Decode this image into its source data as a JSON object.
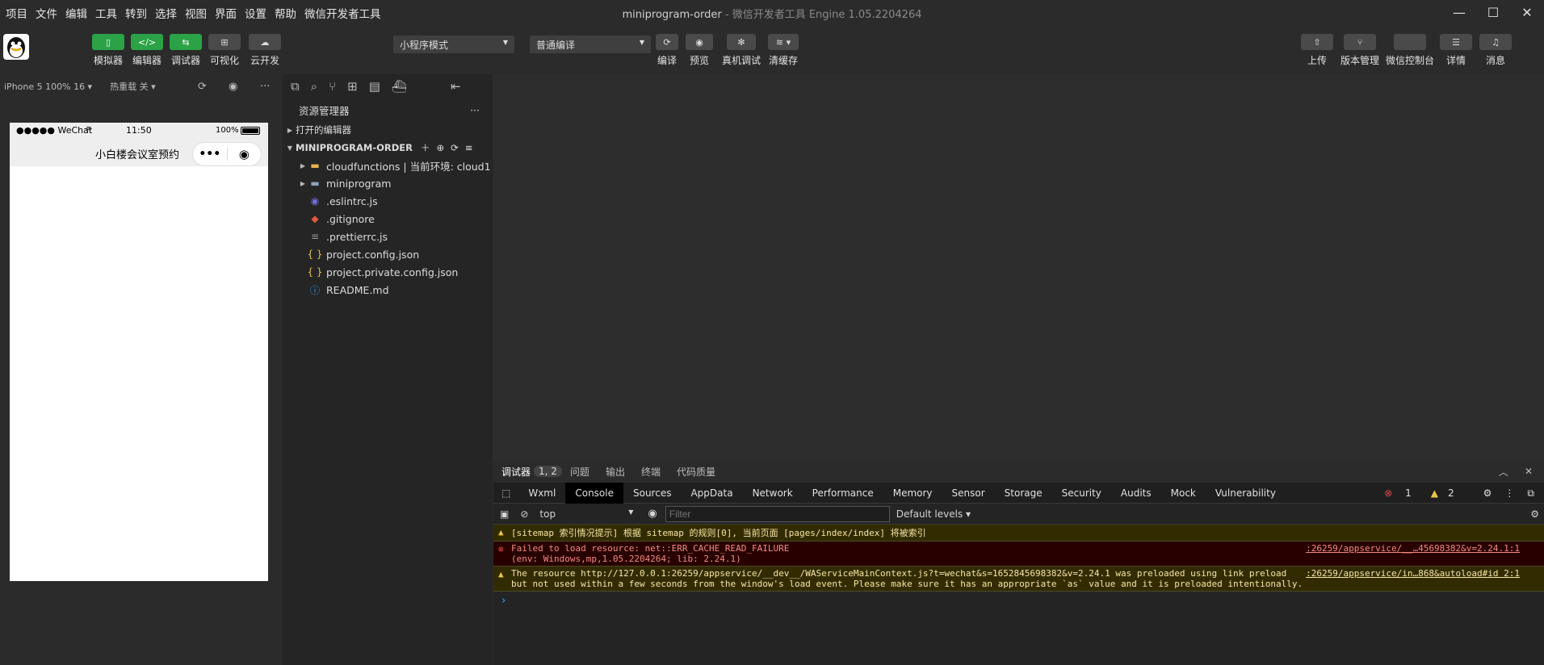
{
  "menu": [
    "项目",
    "文件",
    "编辑",
    "工具",
    "转到",
    "选择",
    "视图",
    "界面",
    "设置",
    "帮助",
    "微信开发者工具"
  ],
  "window": {
    "title": "miniprogram-order",
    "subtitle": " - 微信开发者工具 Engine 1.05.2204264"
  },
  "toolbar": {
    "left_buttons": [
      "模拟器",
      "编辑器",
      "调试器",
      "可视化",
      "云开发"
    ],
    "mode_select": "小程序模式",
    "compile_select": "普通编译",
    "mid_buttons": [
      "编译",
      "预览",
      "真机调试",
      "清缓存"
    ],
    "right_buttons": [
      "上传",
      "版本管理",
      "微信控制台",
      "详情",
      "消息"
    ]
  },
  "simulator": {
    "device": "iPhone 5 100% 16 ▾",
    "hotreload": "热重载 关 ▾",
    "status_left": "●●●●● WeChat",
    "status_time": "11:50",
    "status_battery": "100%",
    "nav_title": "小白楼会议室预约"
  },
  "explorer": {
    "title": "资源管理器",
    "open_editors": "打开的编辑器",
    "project": "MINIPROGRAM-ORDER",
    "items": [
      {
        "name": "cloudfunctions | 当前环境: cloud1",
        "icon": "folder-icon",
        "color": "#e8b34a",
        "folder": true
      },
      {
        "name": "miniprogram",
        "icon": "folder-icon",
        "color": "#8fa3b8",
        "folder": true
      },
      {
        "name": ".eslintrc.js",
        "icon": "eslint-icon",
        "color": "#6f6fd8",
        "folder": false
      },
      {
        "name": ".gitignore",
        "icon": "git-icon",
        "color": "#e0583a",
        "folder": false
      },
      {
        "name": ".prettierrc.js",
        "icon": "config-icon",
        "color": "#9a9a9a",
        "folder": false
      },
      {
        "name": "project.config.json",
        "icon": "json-icon",
        "color": "#e2c04a",
        "folder": false
      },
      {
        "name": "project.private.config.json",
        "icon": "json-icon",
        "color": "#e2c04a",
        "folder": false
      },
      {
        "name": "README.md",
        "icon": "info-icon",
        "color": "#3aa0e8",
        "folder": false
      }
    ]
  },
  "debugger": {
    "tabs": [
      "调试器",
      "1, 2",
      "问题",
      "输出",
      "终端",
      "代码质量"
    ],
    "devtabs": [
      "Wxml",
      "Console",
      "Sources",
      "AppData",
      "Network",
      "Performance",
      "Memory",
      "Sensor",
      "Storage",
      "Security",
      "Audits",
      "Mock",
      "Vulnerability"
    ],
    "active_devtab": "Console",
    "error_count": "1",
    "warn_count": "2",
    "context": "top",
    "filter_placeholder": "Filter",
    "levels": "Default levels ▾",
    "messages": [
      {
        "type": "warn",
        "text": "[sitemap 索引情况提示] 根据 sitemap 的规则[0], 当前页面 [pages/index/index] 将被索引",
        "source": ""
      },
      {
        "type": "error",
        "text": "Failed to load resource: net::ERR_CACHE_READ_FAILURE",
        "text2": "(env: Windows,mp,1.05.2204264; lib: 2.24.1)",
        "source": ":26259/appservice/__…45698382&v=2.24.1:1"
      },
      {
        "type": "warn",
        "text": "The resource http://127.0.0.1:26259/appservice/__dev__/WAServiceMainContext.js?t=wechat&s=1652845698382&v=2.24.1 was preloaded using link preload",
        "text2": "but not used within a few seconds from the window's load event. Please make sure it has an appropriate `as` value and it is preloaded intentionally.",
        "source": ":26259/appservice/in…868&autoload#id 2:1"
      }
    ],
    "prompt": "›"
  },
  "colors": {
    "green": "#2ba245",
    "warn_bg": "#332b00",
    "error_bg": "#290000"
  }
}
